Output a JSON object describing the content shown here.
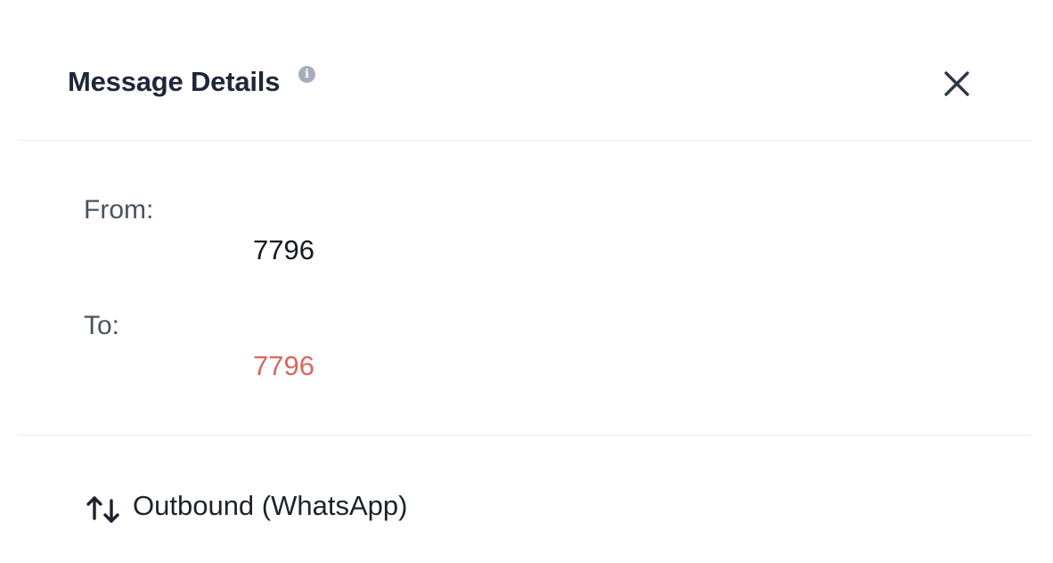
{
  "header": {
    "title": "Message Details",
    "info_icon": "info-icon",
    "close_icon": "close-icon"
  },
  "details": {
    "from_label": "From:",
    "from_value": "7796",
    "to_label": "To:",
    "to_value": "7796"
  },
  "footer": {
    "direction_icon": "arrows-up-down-icon",
    "direction_text": "Outbound (WhatsApp)"
  },
  "colors": {
    "to_value": "#d8685e",
    "title": "#1f2637",
    "divider": "#e9ebef"
  }
}
